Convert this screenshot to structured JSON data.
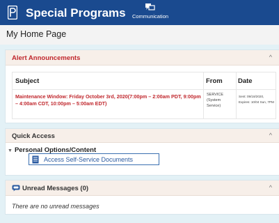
{
  "header": {
    "app_title": "Special Programs",
    "nav_communication": "Communication"
  },
  "page": {
    "title": "My Home Page"
  },
  "alerts": {
    "title": "Alert Announcements",
    "columns": {
      "subject": "Subject",
      "from": "From",
      "date": "Date"
    },
    "row": {
      "subject": "Maintenance Window: Friday October 3rd, 2020(7:00pm – 2:00am PDT, 9:00pm – 4:00am CDT, 10:00pm – 5:00am EDT)",
      "from": "SERVICE (System Service)",
      "sent": "Sent: 09/18/2020,",
      "expires": "Expires: 10/04 Sun, 7PM"
    }
  },
  "quick_access": {
    "title": "Quick Access",
    "group": "Personal Options/Content",
    "link": "Access Self-Service Documents"
  },
  "messages": {
    "title": "Unread Messages (0)",
    "empty": "There are no unread messages"
  },
  "icons": {
    "logo": "powerschool-logo-icon",
    "communication": "communication-icon",
    "collapse": "chevron-up-icon",
    "document": "document-icon",
    "messages": "message-bubble-icon"
  },
  "colors": {
    "header": "#1a4a8f",
    "alert_red": "#c0272d",
    "link_blue": "#2a5aa0",
    "panel_header": "#f7efe9",
    "background": "#e3f1f6"
  }
}
